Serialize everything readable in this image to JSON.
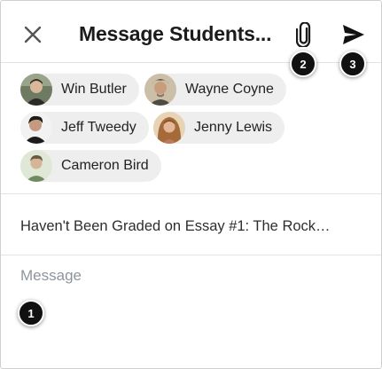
{
  "header": {
    "title": "Message Students...",
    "close_icon": "close-icon",
    "attach_icon": "paperclip-icon",
    "send_icon": "send-icon"
  },
  "recipients": [
    {
      "name": "Win Butler",
      "avatar_color": "#5b6b4e"
    },
    {
      "name": "Wayne Coyne",
      "avatar_color": "#7a6a55"
    },
    {
      "name": "Jeff Tweedy",
      "avatar_color": "#2d2a26"
    },
    {
      "name": "Jenny Lewis",
      "avatar_color": "#b58a5a"
    },
    {
      "name": "Cameron Bird",
      "avatar_color": "#a8b89a"
    }
  ],
  "subject": "Haven't Been Graded on Essay #1: The Rock…",
  "message": {
    "value": "",
    "placeholder": "Message"
  },
  "callouts": [
    "1",
    "2",
    "3"
  ],
  "colors": {
    "chip_bg": "#eeeeee",
    "divider": "#e3e3e3",
    "callout_bg": "#111111"
  }
}
